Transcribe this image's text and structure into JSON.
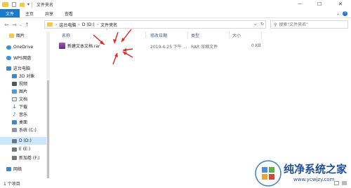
{
  "window": {
    "title": "文件夹名",
    "minimize": "—",
    "maximize": "☐",
    "close": "✕"
  },
  "ribbon": {
    "tabs": [
      "文件",
      "主页",
      "共享",
      "查看"
    ],
    "help": "?"
  },
  "address": {
    "crumbs": [
      "这台电脑",
      "D (D:)",
      "文件夹名"
    ],
    "search_placeholder": "搜索\"文件夹名\""
  },
  "sidebar": {
    "items": [
      "图片",
      "OneDrive",
      "WPS网盘",
      "这台电脑",
      "3D 对象",
      "视频",
      "图片",
      "文档",
      "下载",
      "音乐",
      "桌面",
      "系统 (C:)",
      "D (D:)",
      "E (E:)",
      "新加卷 (F:)",
      "网络"
    ]
  },
  "columns": {
    "name": "名称",
    "modified": "修改日期",
    "type": "类型",
    "size": "大小"
  },
  "files": [
    {
      "name": "新建文本文档.rar",
      "modified": "2019-4-25 下午 ...",
      "type": "RAR 压缩文件",
      "size": "0 KB"
    }
  ],
  "status": {
    "count": "1 个项目"
  },
  "watermark": {
    "brand": "纯净系统之家",
    "url": "www.ycwjzy.com"
  },
  "colors": {
    "accent": "#1979ca",
    "arrow": "#e8221b",
    "selected": "#cce8ff"
  }
}
